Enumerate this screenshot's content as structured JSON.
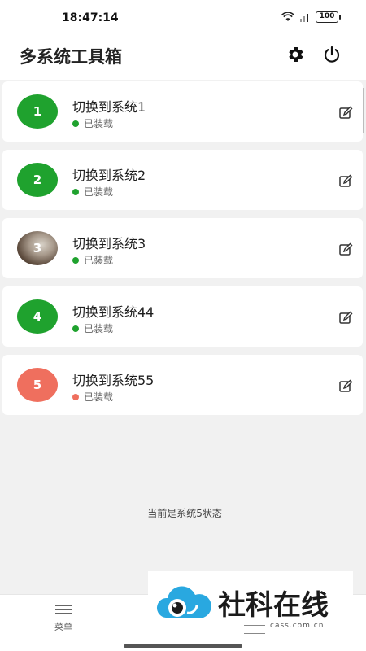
{
  "status_bar": {
    "time": "18:47:14",
    "battery": "100"
  },
  "header": {
    "title": "多系统工具箱",
    "settings_icon": "gear-icon",
    "power_icon": "power-icon"
  },
  "systems": [
    {
      "badge": "1",
      "title": "切换到系统1",
      "status": "已装载",
      "color": "#1fa22e",
      "dot_color": "#1fa22e"
    },
    {
      "badge": "2",
      "title": "切换到系统2",
      "status": "已装载",
      "color": "#1fa22e",
      "dot_color": "#1fa22e"
    },
    {
      "badge": "3",
      "title": "切换到系统3",
      "status": "已装载",
      "color": "image",
      "dot_color": "#1fa22e"
    },
    {
      "badge": "4",
      "title": "切换到系统44",
      "status": "已装载",
      "color": "#1fa22e",
      "dot_color": "#1fa22e"
    },
    {
      "badge": "5",
      "title": "切换到系统55",
      "status": "已装载",
      "color": "#ef6f5e",
      "dot_color": "#ef6f5e"
    }
  ],
  "current_state": "当前是系统5状态",
  "bottom_nav": {
    "menu_label": "菜单",
    "menu_icon": "menu-icon"
  },
  "watermark": {
    "name": "社科在线",
    "url": "cass.com.cn"
  }
}
